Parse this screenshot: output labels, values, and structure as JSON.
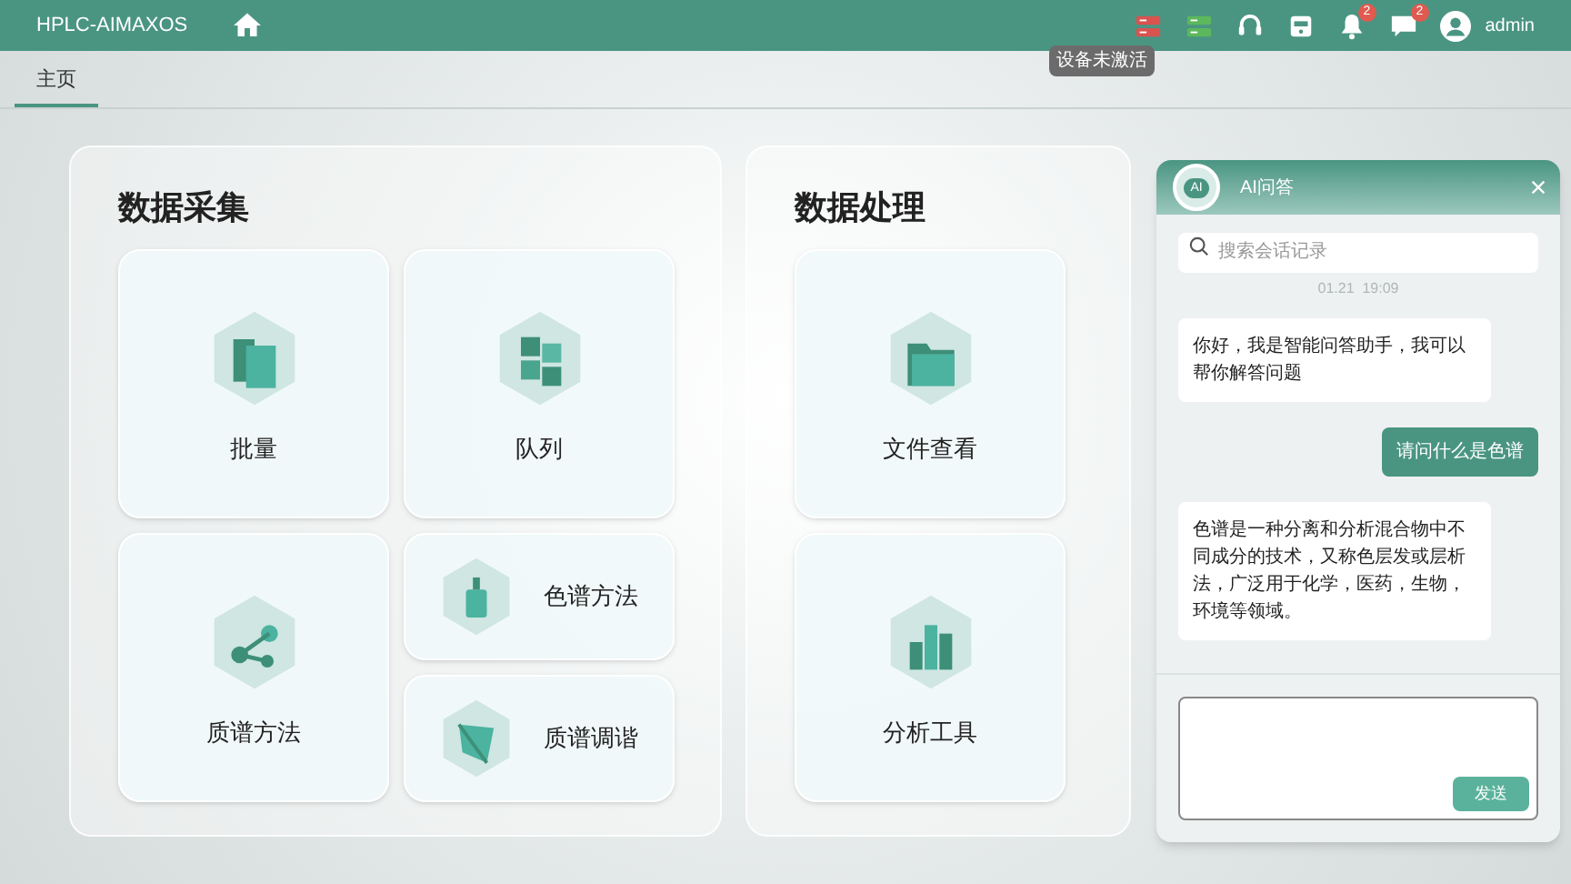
{
  "app_title": "HPLC-AIMAXOS",
  "header_icons": [
    {
      "kind": "server",
      "color": "#d9534f"
    },
    {
      "kind": "server",
      "color": "#5cb85c"
    },
    {
      "kind": "support"
    },
    {
      "kind": "device"
    },
    {
      "kind": "bell",
      "badge": "2"
    },
    {
      "kind": "chat",
      "badge": "2"
    }
  ],
  "tooltip": "设备未激活",
  "user": "admin",
  "tabs": [
    {
      "label": "主页",
      "selected": true
    }
  ],
  "sections": [
    {
      "title": "数据采集",
      "cards": [
        {
          "label": "批量",
          "kind": "large"
        },
        {
          "label": "队列",
          "kind": "large"
        },
        {
          "label": "质谱方法",
          "kind": "large"
        },
        {
          "label": "色谱方法",
          "kind": "small"
        },
        {
          "label": "质谱调谐",
          "kind": "small"
        }
      ]
    },
    {
      "title": "数据处理",
      "cards": [
        {
          "label": "文件查看",
          "kind": "large"
        },
        {
          "label": "分析工具",
          "kind": "large"
        }
      ]
    }
  ],
  "chat": {
    "badge": "AI",
    "title": "AI问答",
    "search_placeholder": "搜索会话记录",
    "timestamp": "01.21  19:09",
    "messages": [
      {
        "kind": "bot",
        "text": "你好，我是智能问答助手，我可以帮你解答问题"
      },
      {
        "kind": "user",
        "text": "请问什么是色谱"
      },
      {
        "kind": "bot",
        "text": "色谱是一种分离和分析混合物中不同成分的技术，又称色层发或层析法，广泛用于化学，医药，生物，环境等领域。"
      }
    ],
    "send_button": "发送"
  }
}
